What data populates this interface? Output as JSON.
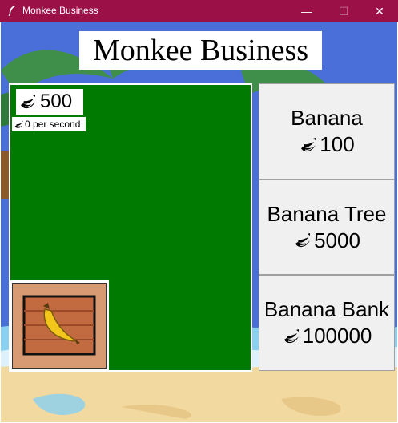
{
  "window": {
    "title": "Monkee Business",
    "minimize_glyph": "—",
    "maximize_glyph": "☐",
    "close_glyph": "✕",
    "titlebar_color": "#9c1048"
  },
  "game": {
    "title": "Monkee Business",
    "balance": "500",
    "rate": "0 per second",
    "banana_icon": "banana-icon",
    "field_color": "#007a00"
  },
  "shop": {
    "items": [
      {
        "name": "Banana",
        "price": "100"
      },
      {
        "name": "Banana Tree",
        "price": "5000"
      },
      {
        "name": "Banana Bank",
        "price": "100000"
      }
    ]
  },
  "colors": {
    "sky": "#4a6fd9",
    "sand": "#f2d9a0",
    "water": "#8ad0f0",
    "leaf": "#3f8f4a",
    "crate": "#d89a72",
    "button_face": "#f0f0f0"
  }
}
